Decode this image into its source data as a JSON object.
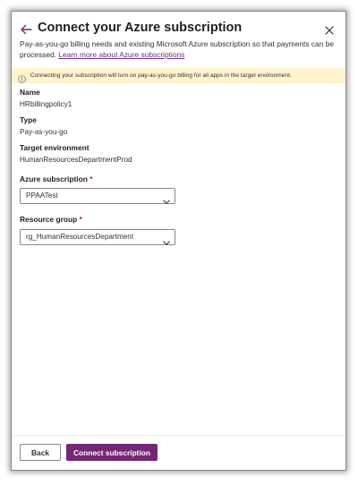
{
  "panel": {
    "title": "Connect your Azure subscription",
    "description": "Pay-as-you-go billing needs and existing Microsoft Azure subscription so that payments can be processed.",
    "learn_more_link": "Learn more about Azure subscriptions",
    "accent_color": "#742774"
  },
  "warning": {
    "text": "Connecting your subscription will turn on pay-as-you-go billing for all apps in the target environment.",
    "background_color": "#fff4ce",
    "icon": "info-icon"
  },
  "fields": {
    "name": {
      "label": "Name",
      "value": "HRbillingpolicy1"
    },
    "type": {
      "label": "Type",
      "value": "Pay-as-you-go"
    },
    "target_environment": {
      "label": "Target environment",
      "value": "HumanResourcesDepartmentProd"
    },
    "azure_subscription": {
      "label": "Azure subscription",
      "required_marker": "*",
      "selected": "PPAATest"
    },
    "resource_group": {
      "label": "Resource group",
      "required_marker": "*",
      "selected": "rg_HumanResourcesDepartment"
    }
  },
  "footer": {
    "back_label": "Back",
    "connect_label": "Connect subscription"
  }
}
